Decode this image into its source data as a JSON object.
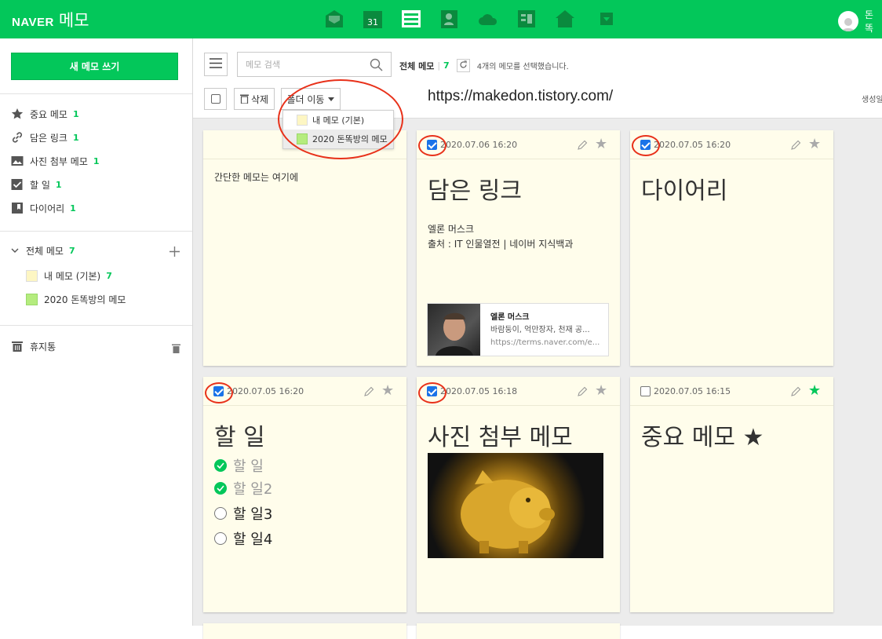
{
  "header": {
    "logo_brand": "NAVER",
    "logo_app": "메모",
    "calendar_day": "31",
    "user_name": "돈똑",
    "apps": [
      "mail-icon",
      "calendar-icon",
      "memo-icon",
      "contacts-icon",
      "cloud-icon",
      "office-icon",
      "works-icon",
      "more-apps-icon"
    ]
  },
  "sidebar": {
    "new_memo": "새 메모 쓰기",
    "filters": [
      {
        "label": "중요 메모",
        "count": "1",
        "icon": "star-icon"
      },
      {
        "label": "담은 링크",
        "count": "1",
        "icon": "link-icon"
      },
      {
        "label": "사진 첨부 메모",
        "count": "1",
        "icon": "photo-icon"
      },
      {
        "label": "할 일",
        "count": "1",
        "icon": "todo-icon"
      },
      {
        "label": "다이어리",
        "count": "1",
        "icon": "bookmark-icon"
      }
    ],
    "all_memos": {
      "label": "전체 메모",
      "count": "7"
    },
    "folders": [
      {
        "label": "내 메모 (기본)",
        "count": "7",
        "color": "#fdf6c3"
      },
      {
        "label": "2020 돈똑방의 메모",
        "count": "",
        "color": "#b5ec7e"
      }
    ],
    "trash": "휴지통"
  },
  "toolbar": {
    "search_placeholder": "메모 검색",
    "crumb_title": "전체 메모",
    "crumb_count": "7",
    "selection_text": "4개의 메모를 선택했습니다.",
    "delete_label": "삭제",
    "move_label": "폴더 이동",
    "url_title": "https://makedon.tistory.com/",
    "created_label": "생성일"
  },
  "move_menu": [
    {
      "label": "내 메모 (기본)",
      "color": "#fdf6c3"
    },
    {
      "label": "2020 돈똑방의 메모",
      "color": "#b5ec7e"
    }
  ],
  "cards": [
    {
      "body": "간단한 메모는 여기에"
    },
    {
      "checked": true,
      "date": "2020.07.06 16:20",
      "title": "담은 링크",
      "line1": "엘론 머스크",
      "line2": "출처 : IT 인물열전 | 네이버 지식백과",
      "link": {
        "title": "엘론 머스크",
        "desc": "바람둥이, 억만장자, 천재 공...",
        "url": "https://terms.naver.com/e..."
      }
    },
    {
      "checked": true,
      "date": "2020.07.05 16:20",
      "title": "다이어리"
    },
    {
      "checked": true,
      "date": "2020.07.05 16:20",
      "title": "할 일",
      "todos": [
        {
          "text": "할 일",
          "done": true
        },
        {
          "text": "할 일2",
          "done": true
        },
        {
          "text": "할 일3",
          "done": false
        },
        {
          "text": "할 일4",
          "done": false
        }
      ]
    },
    {
      "checked": true,
      "date": "2020.07.05 16:18",
      "title": "사진 첨부 메모"
    },
    {
      "checked": false,
      "date": "2020.07.05 16:15",
      "title": "중요 메모 ★",
      "starred": true
    }
  ],
  "colors": {
    "brand": "#03c75a",
    "annotation": "#e8311a",
    "checkbox": "#1a73e8"
  }
}
